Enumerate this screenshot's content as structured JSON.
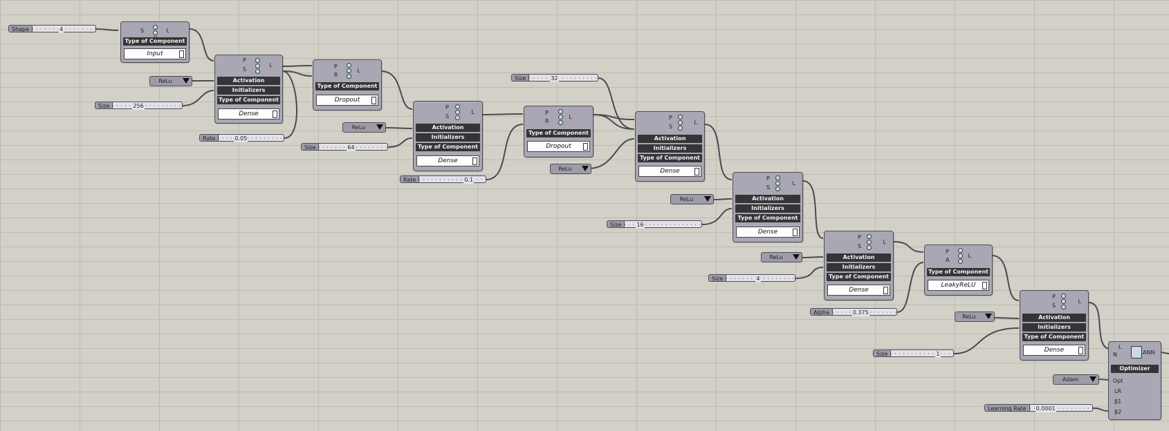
{
  "sliders": [
    {
      "label": "Shape",
      "value": "4"
    },
    {
      "label": "Size",
      "value": "256"
    },
    {
      "label": "Rate",
      "value": "0.05"
    },
    {
      "label": "Size",
      "value": "64"
    },
    {
      "label": "Rate",
      "value": "0.1"
    },
    {
      "label": "Size",
      "value": "32"
    },
    {
      "label": "Size",
      "value": "16"
    },
    {
      "label": "Size",
      "value": "4"
    },
    {
      "label": "Alpha",
      "value": "0.375"
    },
    {
      "label": "Size",
      "value": "1"
    },
    {
      "label": "Learning Rate",
      "value": "0.0001"
    }
  ],
  "dropdowns": [
    "ReLu",
    "ReLu",
    "ReLu",
    "ReLu",
    "ReLu",
    "ReLu",
    "Adam"
  ],
  "labels": {
    "type_of_component": "Type of Component",
    "activation": "Activation",
    "initializers": "Initializers",
    "optimizer": "Optimizer"
  },
  "pins": {
    "S": "S",
    "L": "L",
    "P": "P",
    "R": "R",
    "A": "A",
    "N": "N",
    "ANN": "ANN",
    "Opt": "Opt",
    "LR": "LR",
    "B1": "β1",
    "B2": "β2"
  },
  "values": {
    "input": "Input",
    "dense": "Dense",
    "dropout": "Dropout",
    "leaky": "LeakyReLU"
  }
}
